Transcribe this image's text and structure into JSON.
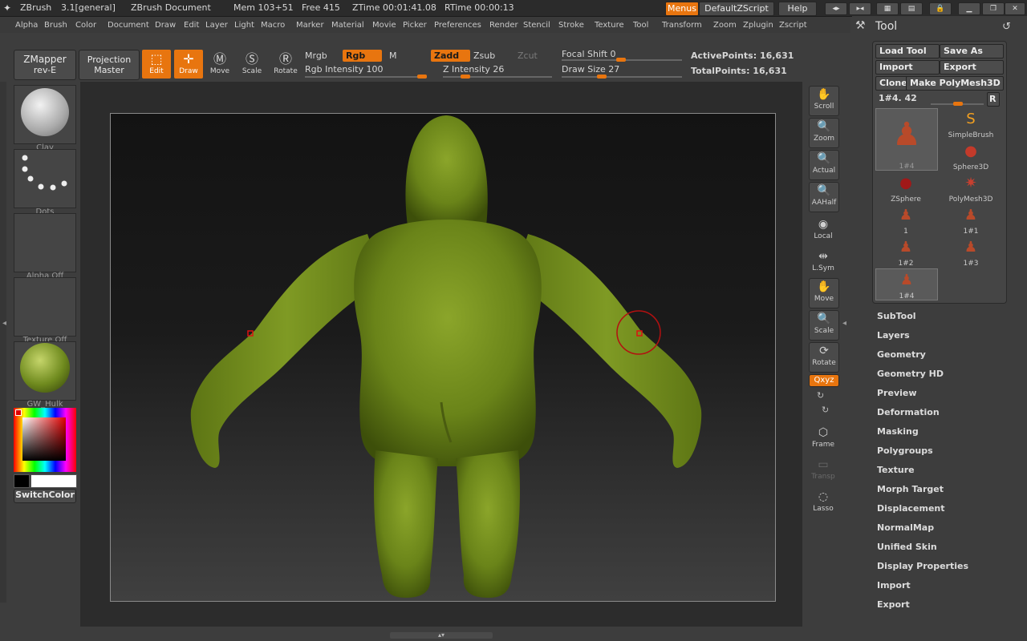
{
  "titlebar": {
    "app": "ZBrush",
    "version": "3.1[general]",
    "doc": "ZBrush Document",
    "mem": "Mem 103+51",
    "free": "Free 415",
    "ztime": "ZTime 00:01:41.08",
    "rtime": "RTime 00:00:13",
    "menus_btn": "Menus",
    "script_btn": "DefaultZScript",
    "help_btn": "Help"
  },
  "menubar": [
    "Alpha",
    "Brush",
    "Color",
    "Document",
    "Draw",
    "Edit",
    "Layer",
    "Light",
    "Macro",
    "Marker",
    "Material",
    "Movie",
    "Picker",
    "Preferences",
    "Render",
    "Stencil",
    "Stroke",
    "Texture",
    "Tool",
    "Transform",
    "Zoom",
    "Zplugin",
    "Zscript"
  ],
  "shelf": {
    "zmapper_l1": "ZMapper",
    "zmapper_l2": "rev-E",
    "projection_l1": "Projection",
    "projection_l2": "Master",
    "tools": [
      "Edit",
      "Draw",
      "Move",
      "Scale",
      "Rotate"
    ],
    "mrgb": "Mrgb",
    "rgb": "Rgb",
    "m": "M",
    "rgb_intensity": "Rgb Intensity 100",
    "zadd": "Zadd",
    "zsub": "Zsub",
    "zcut": "Zcut",
    "z_intensity": "Z Intensity 26",
    "focal_shift": "Focal Shift 0",
    "draw_size": "Draw Size 27",
    "active_points": "ActivePoints: 16,631",
    "total_points": "TotalPoints: 16,631"
  },
  "left_tray": {
    "items": [
      "Clay",
      "Dots",
      "Alpha Off",
      "Texture Off",
      "GW_Hulk"
    ],
    "switch_color": "SwitchColor"
  },
  "right_strip": [
    "Scroll",
    "Zoom",
    "Actual",
    "AAHalf",
    "Local",
    "L.Sym",
    "Move",
    "Scale",
    "Rotate",
    "Qxyz",
    "Frame",
    "Transp",
    "Lasso"
  ],
  "tool_panel": {
    "title": "Tool",
    "load_tool": "Load Tool",
    "save_as": "Save As",
    "import": "Import",
    "export": "Export",
    "clone": "Clone",
    "make_polymesh": "Make PolyMesh3D",
    "slider_label": "1#4. 42",
    "r_btn": "R",
    "thumbs": [
      "1#4",
      "SimpleBrush",
      "Sphere3D",
      "ZSphere",
      "PolyMesh3D",
      "1",
      "1#1",
      "1#2",
      "1#3",
      "1#4"
    ]
  },
  "sections": [
    "SubTool",
    "Layers",
    "Geometry",
    "Geometry HD",
    "Preview",
    "Deformation",
    "Masking",
    "Polygroups",
    "Texture",
    "Morph Target",
    "Displacement",
    "NormalMap",
    "Unified Skin",
    "Display Properties",
    "Import",
    "Export"
  ],
  "colors": {
    "accent": "#e8750f",
    "model": "#6f8a1e"
  }
}
